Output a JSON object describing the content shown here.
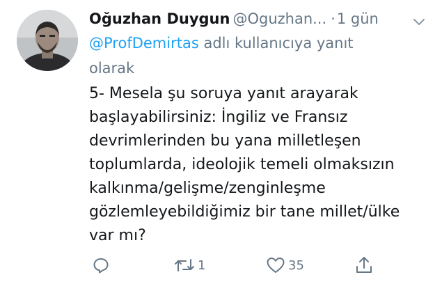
{
  "tweet": {
    "author_name": "Oğuzhan Duygun",
    "author_handle": "@Oguzhan...",
    "separator": "·",
    "time": "1 gün",
    "reply_mention": "@ProfDemirtas",
    "reply_suffix_line1": " adlı kullanıcıya yanıt",
    "reply_suffix_line2": "olarak",
    "body_lines": [
      "5- Mesela şu soruya yanıt arayarak",
      "başlayabilirsiniz: İngiliz ve Fransız",
      "devrimlerinden bu yana milletleşen",
      "toplumlarda, ideolojik temeli olmaksızın",
      "kalkınma/gelişme/zenginleşme",
      "gözlemleyebildiğimiz bir tane millet/ülke",
      "var mı?"
    ]
  },
  "actions": {
    "retweet_count": "1",
    "like_count": "35"
  },
  "icons": {
    "avatar": "avatar",
    "caret": "chevron-down-icon",
    "reply": "reply-icon",
    "retweet": "retweet-icon",
    "like": "heart-icon",
    "share": "share-icon"
  },
  "colors": {
    "text": "#14171a",
    "secondary": "#657786",
    "link": "#1da1f2"
  }
}
